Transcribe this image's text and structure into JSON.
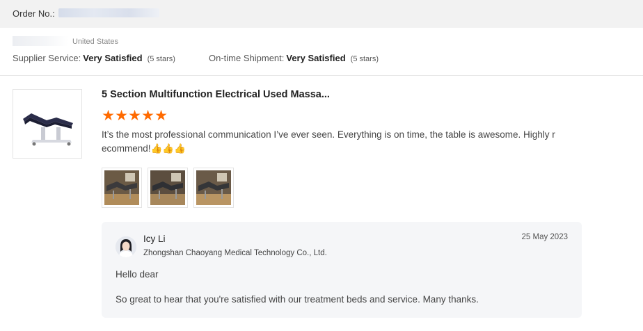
{
  "order": {
    "label": "Order No.:"
  },
  "buyer": {
    "country": "United States"
  },
  "ratings": [
    {
      "label": "Supplier Service:",
      "value": "Very Satisfied",
      "stars": "(5 stars)"
    },
    {
      "label": "On-time Shipment:",
      "value": "Very Satisfied",
      "stars": "(5 stars)"
    }
  ],
  "review": {
    "product_title": "5 Section Multifunction Electrical Used Massa...",
    "star_count": 5,
    "text": "It’s the most professional communication I’ve ever seen. Everything is on time, the table is awesome. Highly recommend!👍👍👍",
    "photos": [
      "photo-1",
      "photo-2",
      "photo-3"
    ]
  },
  "reply": {
    "name": "Icy Li",
    "company": "Zhongshan Chaoyang Medical Technology Co., Ltd.",
    "date": "25 May 2023",
    "lines": [
      "Hello dear",
      "So great to hear that you're satisfied with our treatment beds and service. Many thanks."
    ]
  },
  "colors": {
    "star": "#ff6a00",
    "topbar": "#f2f2f2",
    "reply_bg": "#f5f6f8"
  },
  "icons": {
    "star": "star-icon"
  }
}
